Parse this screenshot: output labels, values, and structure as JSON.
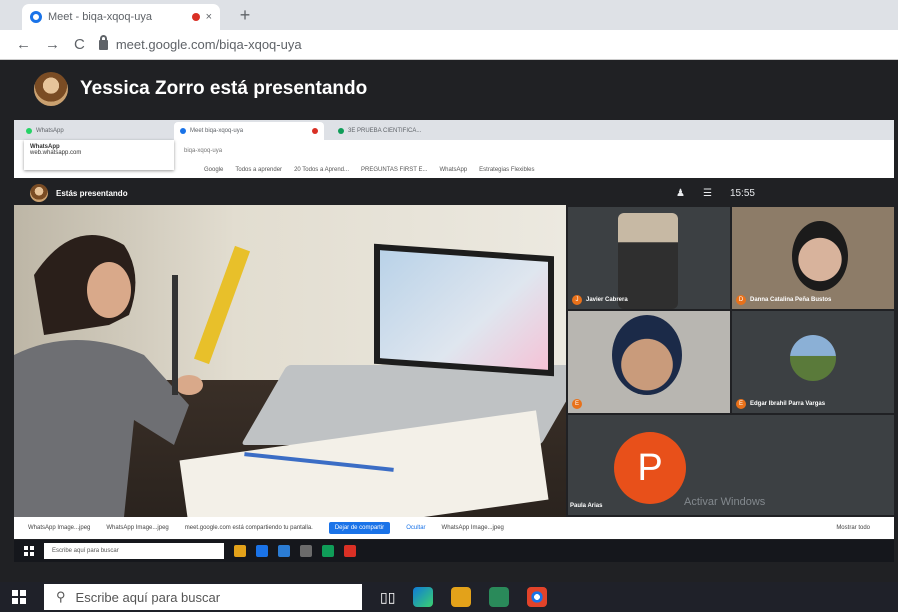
{
  "browser": {
    "tab_title": "Meet - biqa-xqoq-uya",
    "tab_close": "×",
    "new_tab": "+",
    "back": "←",
    "forward": "→",
    "reload": "C",
    "url": "meet.google.com/biqa-xqoq-uya"
  },
  "meet": {
    "presenter_text": "Yessica Zorro está presentando"
  },
  "shared_screen": {
    "tabs": [
      {
        "label": "WhatsApp"
      },
      {
        "label": "Meet biqa-xqoq-uya"
      },
      {
        "label": "3E PRUEBA CIENTIFICA..."
      }
    ],
    "tooltip_title": "WhatsApp",
    "tooltip_url": "web.whatsapp.com",
    "url": "biqa-xqoq-uya",
    "bookmarks": [
      "Google",
      "Todos a aprender",
      "20 Todos a Aprend...",
      "PREGUNTAS FIRST E...",
      "WhatsApp",
      "Estrategias Flexibles"
    ],
    "inner_presenting": "Estás presentando",
    "time": "15:55",
    "people": [
      {
        "name": "Javier Cabrera",
        "initial": "J"
      },
      {
        "name": "Danna Catalina Peña Bustos",
        "initial": "D"
      },
      {
        "name": "",
        "initial": "E"
      },
      {
        "name": "Edgar Ibrahil Parra Vargas",
        "initial": "E"
      },
      {
        "name": "Paula Arias",
        "initial": "P"
      }
    ],
    "p_avatar": "P",
    "activate_windows": "Activar Windows",
    "downloads": [
      "WhatsApp Image...jpeg",
      "WhatsApp Image...jpeg",
      "WhatsApp Image...jpeg"
    ],
    "share_notice": "meet.google.com está compartiendo tu pantalla.",
    "share_stop": "Dejar de compartir",
    "share_hide": "Ocultar",
    "show_all": "Mostrar todo",
    "inner_search": "Escribe aquí para buscar"
  },
  "taskbar": {
    "search_placeholder": "Escribe aquí para buscar"
  },
  "colors": {
    "meet_bg": "#202124",
    "accent": "#1a73e8",
    "record": "#d93025",
    "avatar_orange": "#e8501a"
  }
}
